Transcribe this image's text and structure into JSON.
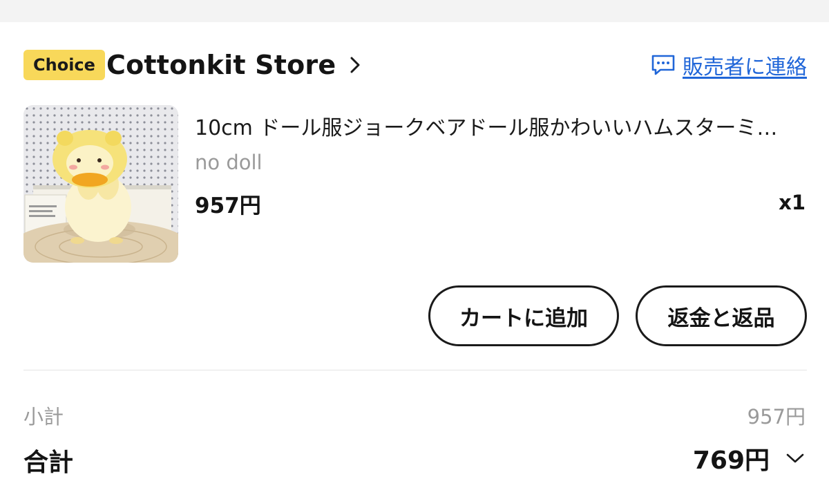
{
  "store": {
    "badge": "Choice",
    "name": "Cottonkit Store",
    "contact_label": "販売者に連絡",
    "colors": {
      "badge_bg": "#f8d85a",
      "link": "#2066d8"
    }
  },
  "product": {
    "title": "10cm ドール服ジョークベアドール服かわいいハムスターミ…",
    "variant": "no doll",
    "price": "957円",
    "quantity": "x1",
    "image_icon": "hamster-doll-photo"
  },
  "actions": {
    "add_to_cart": "カートに追加",
    "refund_return": "返金と返品"
  },
  "summary": {
    "subtotal_label": "小計",
    "subtotal_value": "957円",
    "total_label": "合計",
    "total_value": "769円"
  }
}
